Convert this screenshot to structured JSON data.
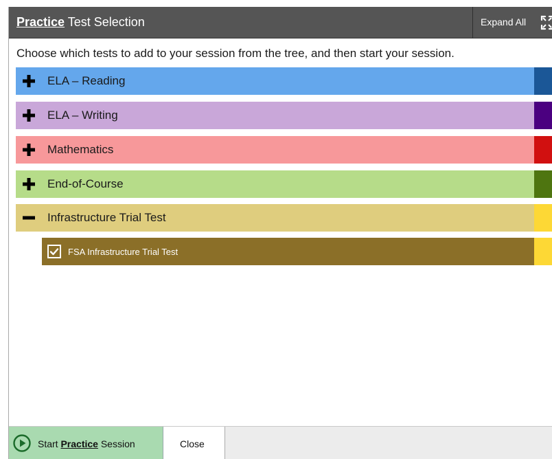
{
  "header": {
    "title_emphasis": "Practice",
    "title_rest": " Test Selection",
    "expand_all_label": "Expand All"
  },
  "instructions": "Choose which tests to add to your session from the tree, and then start your session.",
  "categories": [
    {
      "label": "ELA – Reading",
      "expanded": false,
      "color": "#64a7ec",
      "stripe_color": "#1b5797"
    },
    {
      "label": "ELA – Writing",
      "expanded": false,
      "color": "#c9a7d9",
      "stripe_color": "#4b0080"
    },
    {
      "label": "Mathematics",
      "expanded": false,
      "color": "#f7989a",
      "stripe_color": "#d11010"
    },
    {
      "label": "End-of-Course",
      "expanded": false,
      "color": "#b6dc89",
      "stripe_color": "#4e7510"
    },
    {
      "label": "Infrastructure Trial Test",
      "expanded": true,
      "color": "#dfcd7e",
      "stripe_color": "#fdd835"
    }
  ],
  "selected_test": {
    "label": "FSA Infrastructure Trial Test",
    "checked": true
  },
  "footer": {
    "start_prefix": "Start ",
    "start_emphasis": "Practice",
    "start_suffix": " Session",
    "close_label": "Close"
  },
  "icons": {
    "expand": "expand-arrows-icon",
    "plus": "plus-icon",
    "minus": "minus-icon",
    "checkbox": "checkmark-icon",
    "start": "play-circle-icon"
  }
}
